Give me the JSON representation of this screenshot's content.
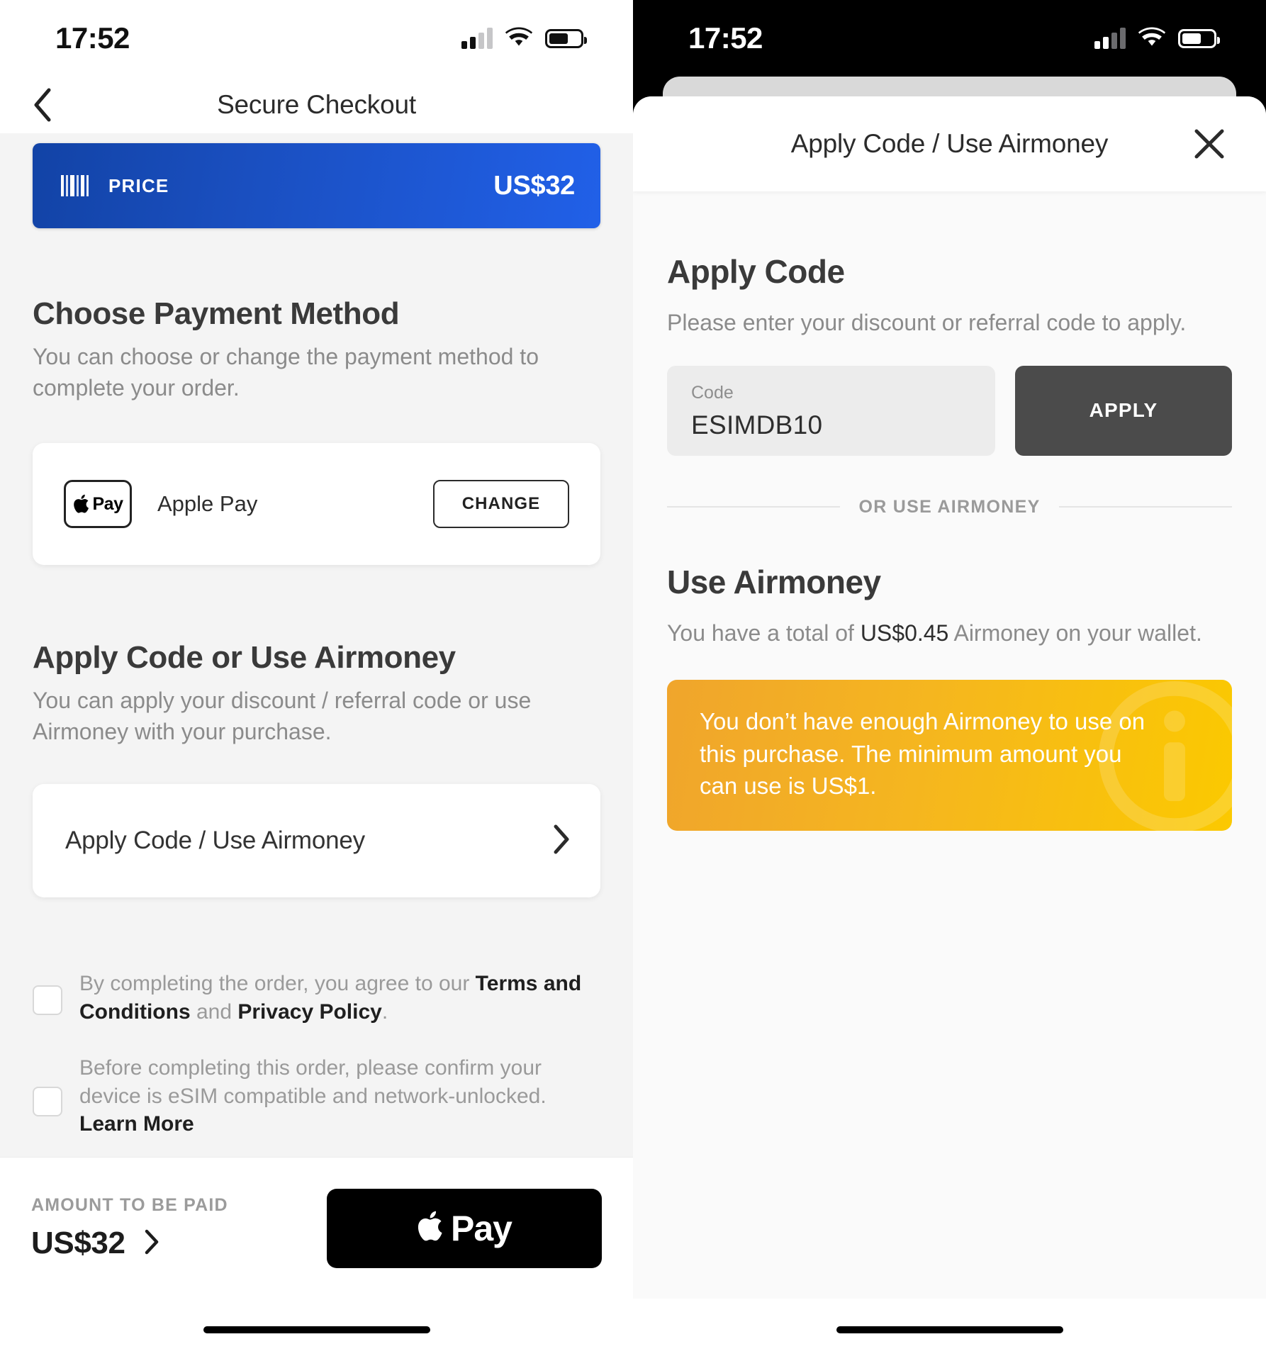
{
  "status_bar": {
    "time": "17:52",
    "signal_icon": "cellular-signal-icon",
    "wifi_icon": "wifi-icon",
    "battery_icon": "battery-icon"
  },
  "left_screen": {
    "nav": {
      "back_icon": "chevron-left-icon",
      "title": "Secure Checkout"
    },
    "price_banner": {
      "barcode_icon": "barcode-icon",
      "label": "PRICE",
      "amount": "US$32",
      "gradient_from": "#1243a6",
      "gradient_to": "#2160e8"
    },
    "payment_section": {
      "title": "Choose Payment Method",
      "subtitle": "You can choose or change the payment method to complete your order.",
      "method_icon": "apple-pay-logo-icon",
      "method_name": "Apple Pay",
      "change_label": "CHANGE"
    },
    "code_section": {
      "title": "Apply Code or Use Airmoney",
      "subtitle": "You can apply your discount / referral code or use Airmoney with your purchase.",
      "row_label": "Apply Code / Use Airmoney",
      "row_chevron_icon": "chevron-right-icon"
    },
    "terms": [
      {
        "checked": false,
        "prefix": "By completing the order, you agree to our ",
        "link1": "Terms and Conditions",
        "middle": " and ",
        "link2": "Privacy Policy",
        "suffix": "."
      },
      {
        "checked": false,
        "prefix": "Before completing this order, please confirm your device is eSIM compatible and network-unlocked. ",
        "link1": "Learn More",
        "middle": "",
        "link2": "",
        "suffix": ""
      }
    ],
    "bottom_bar": {
      "caption": "AMOUNT TO BE PAID",
      "amount": "US$32",
      "amount_chevron_icon": "chevron-right-icon",
      "pay_button_label": "Pay",
      "pay_button_icon": "apple-logo-icon"
    },
    "home_indicator": "home-indicator"
  },
  "right_screen": {
    "sheet": {
      "title": "Apply Code / Use Airmoney",
      "close_icon": "close-x-icon"
    },
    "apply_code": {
      "title": "Apply Code",
      "subtitle": "Please enter your discount or referral code to apply.",
      "field_label": "Code",
      "field_value": "ESIMDB10",
      "field_placeholder": "Code",
      "apply_label": "APPLY",
      "apply_button_color": "#4b4b4b"
    },
    "divider_label": "OR USE AIRMONEY",
    "airmoney": {
      "title": "Use Airmoney",
      "balance_prefix": "You have a total of ",
      "balance_amount": "US$0.45",
      "balance_suffix": " Airmoney on your wallet.",
      "warning": "You don’t have enough Airmoney to use on this purchase. The minimum amount you can use is US$1.",
      "warning_icon": "info-circle-icon",
      "warning_color_from": "#f0a52c",
      "warning_color_to": "#fbc900"
    },
    "home_indicator": "home-indicator"
  }
}
